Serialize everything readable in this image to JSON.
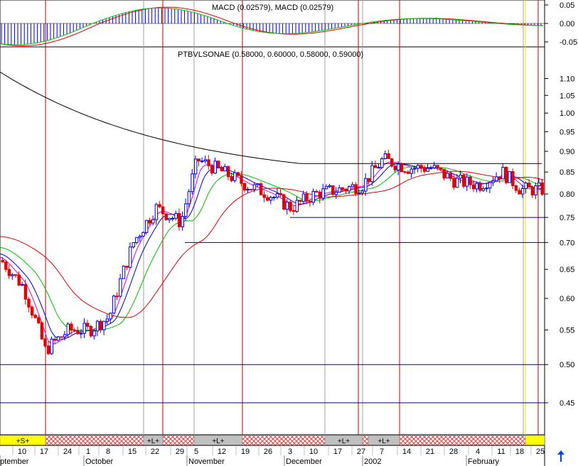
{
  "colors": {
    "up_candle": "#0000e0",
    "down_candle": "#e00000",
    "ma_magenta": "#e000e0",
    "ma_blue": "#0000c0",
    "ma_green": "#00c000",
    "ma_red": "#e00000",
    "ma_black": "#000000",
    "hline": "#000080",
    "vline_red": "#c00000",
    "vline_gray": "#a0a0a0",
    "vline_yellow": "#f0e000",
    "band_yellow": "#ffff00",
    "band_gray": "#c0c0c0",
    "band_hatch": "#e04040",
    "arrow": "#0040ff"
  },
  "macd_panel": {
    "label": "MACD (0.02579), MACD (0.02579)",
    "ticks": [
      "0.05",
      "0.00",
      "-0.05"
    ]
  },
  "price_panel": {
    "label": "PTBVLSONAE (0.58000, 0.60000, 0.58000, 0.59000)",
    "ticks": [
      "1.10",
      "1.05",
      "1.00",
      "0.95",
      "0.90",
      "0.85",
      "0.80",
      "0.75",
      "0.70",
      "0.65",
      "0.60",
      "0.55",
      "0.50",
      "0.45"
    ]
  },
  "signal_bands": [
    {
      "label": "+S+",
      "type": "yellow"
    },
    {
      "label": "",
      "type": "hatch"
    },
    {
      "label": "+L+",
      "type": "gray"
    },
    {
      "label": "",
      "type": "hatch"
    },
    {
      "label": "+L+",
      "type": "gray"
    },
    {
      "label": "",
      "type": "hatch"
    },
    {
      "label": "+L+",
      "type": "gray"
    },
    {
      "label": "",
      "type": "hatch"
    },
    {
      "label": "+L+",
      "type": "gray"
    },
    {
      "label": "",
      "type": "hatch"
    },
    {
      "label": "",
      "type": "yellow"
    }
  ],
  "x_axis": {
    "day_ticks": [
      "10",
      "17",
      "24",
      "1",
      "8",
      "15",
      "22",
      "29",
      "5",
      "12",
      "19",
      "26",
      "3",
      "10",
      "17",
      "27",
      "7",
      "14",
      "21",
      "28",
      "4",
      "11",
      "18",
      "25"
    ],
    "month_labels": [
      "eptember",
      "October",
      "November",
      "December",
      "2002",
      "February"
    ]
  },
  "chart_data": {
    "type": "candlestick",
    "title": "PTBVLSONAE (0.58000, 0.60000, 0.58000, 0.59000)",
    "yscale": "log",
    "ylim": [
      0.42,
      1.15
    ],
    "horizontal_lines": [
      0.75,
      0.7,
      0.5,
      0.45
    ],
    "series_close_approx": [
      {
        "date": "Sep 10",
        "close": 0.62
      },
      {
        "date": "Sep 17",
        "close": 0.52
      },
      {
        "date": "Sep 24",
        "close": 0.55
      },
      {
        "date": "Oct 1",
        "close": 0.55
      },
      {
        "date": "Oct 8",
        "close": 0.57
      },
      {
        "date": "Oct 15",
        "close": 0.7
      },
      {
        "date": "Oct 22",
        "close": 0.77
      },
      {
        "date": "Oct 29",
        "close": 0.74
      },
      {
        "date": "Nov 5",
        "close": 0.88
      },
      {
        "date": "Nov 12",
        "close": 0.85
      },
      {
        "date": "Nov 19",
        "close": 0.82
      },
      {
        "date": "Nov 26",
        "close": 0.8
      },
      {
        "date": "Dec 3",
        "close": 0.77
      },
      {
        "date": "Dec 10",
        "close": 0.8
      },
      {
        "date": "Dec 17",
        "close": 0.81
      },
      {
        "date": "Dec 27",
        "close": 0.82
      },
      {
        "date": "Jan 7",
        "close": 0.88
      },
      {
        "date": "Jan 14",
        "close": 0.86
      },
      {
        "date": "Jan 21",
        "close": 0.86
      },
      {
        "date": "Jan 28",
        "close": 0.83
      },
      {
        "date": "Feb 4",
        "close": 0.82
      },
      {
        "date": "Feb 11",
        "close": 0.85
      },
      {
        "date": "Feb 18",
        "close": 0.81
      },
      {
        "date": "Feb 25",
        "close": 0.81
      }
    ],
    "macd_range": [
      -0.06,
      0.06
    ]
  }
}
